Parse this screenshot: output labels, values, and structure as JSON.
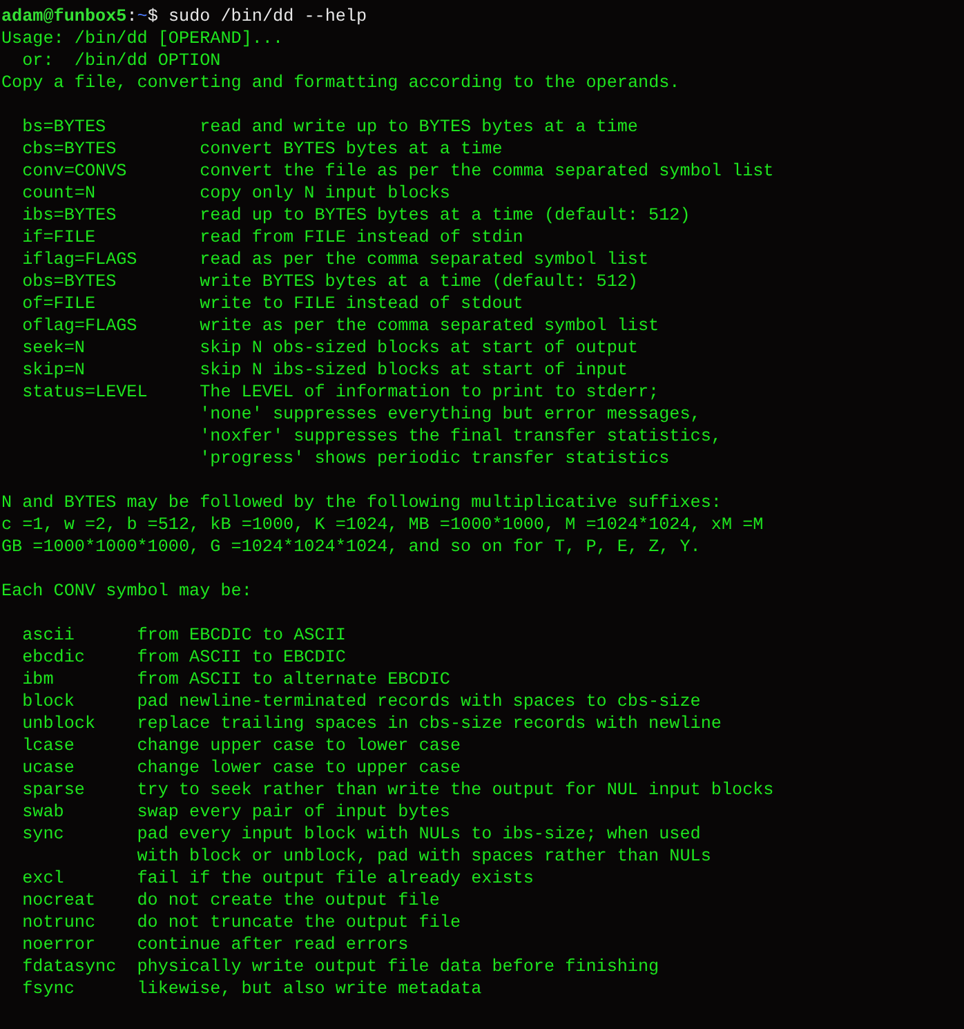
{
  "prompt": {
    "user_host": "adam@funbox5",
    "separator": ":",
    "path": "~",
    "symbol": "$",
    "command": "sudo /bin/dd --help"
  },
  "usage": [
    "Usage: /bin/dd [OPERAND]...",
    "  or:  /bin/dd OPTION",
    "Copy a file, converting and formatting according to the operands."
  ],
  "operands": [
    {
      "name": "bs=BYTES",
      "description": "read and write up to BYTES bytes at a time"
    },
    {
      "name": "cbs=BYTES",
      "description": "convert BYTES bytes at a time"
    },
    {
      "name": "conv=CONVS",
      "description": "convert the file as per the comma separated symbol list"
    },
    {
      "name": "count=N",
      "description": "copy only N input blocks"
    },
    {
      "name": "ibs=BYTES",
      "description": "read up to BYTES bytes at a time (default: 512)"
    },
    {
      "name": "if=FILE",
      "description": "read from FILE instead of stdin"
    },
    {
      "name": "iflag=FLAGS",
      "description": "read as per the comma separated symbol list"
    },
    {
      "name": "obs=BYTES",
      "description": "write BYTES bytes at a time (default: 512)"
    },
    {
      "name": "of=FILE",
      "description": "write to FILE instead of stdout"
    },
    {
      "name": "oflag=FLAGS",
      "description": "write as per the comma separated symbol list"
    },
    {
      "name": "seek=N",
      "description": "skip N obs-sized blocks at start of output"
    },
    {
      "name": "skip=N",
      "description": "skip N ibs-sized blocks at start of input"
    },
    {
      "name": "status=LEVEL",
      "description": "The LEVEL of information to print to stderr;",
      "continuation": [
        "'none' suppresses everything but error messages,",
        "'noxfer' suppresses the final transfer statistics,",
        "'progress' shows periodic transfer statistics"
      ]
    }
  ],
  "suffixes": [
    "N and BYTES may be followed by the following multiplicative suffixes:",
    "c =1, w =2, b =512, kB =1000, K =1024, MB =1000*1000, M =1024*1024, xM =M",
    "GB =1000*1000*1000, G =1024*1024*1024, and so on for T, P, E, Z, Y."
  ],
  "conv_heading": "Each CONV symbol may be:",
  "conv_symbols": [
    {
      "name": "ascii",
      "description": "from EBCDIC to ASCII"
    },
    {
      "name": "ebcdic",
      "description": "from ASCII to EBCDIC"
    },
    {
      "name": "ibm",
      "description": "from ASCII to alternate EBCDIC"
    },
    {
      "name": "block",
      "description": "pad newline-terminated records with spaces to cbs-size"
    },
    {
      "name": "unblock",
      "description": "replace trailing spaces in cbs-size records with newline"
    },
    {
      "name": "lcase",
      "description": "change upper case to lower case"
    },
    {
      "name": "ucase",
      "description": "change lower case to upper case"
    },
    {
      "name": "sparse",
      "description": "try to seek rather than write the output for NUL input blocks"
    },
    {
      "name": "swab",
      "description": "swap every pair of input bytes"
    },
    {
      "name": "sync",
      "description": "pad every input block with NULs to ibs-size; when used",
      "continuation": [
        "with block or unblock, pad with spaces rather than NULs"
      ]
    },
    {
      "name": "excl",
      "description": "fail if the output file already exists"
    },
    {
      "name": "nocreat",
      "description": "do not create the output file"
    },
    {
      "name": "notrunc",
      "description": "do not truncate the output file"
    },
    {
      "name": "noerror",
      "description": "continue after read errors"
    },
    {
      "name": "fdatasync",
      "description": "physically write output file data before finishing"
    },
    {
      "name": "fsync",
      "description": "likewise, but also write metadata"
    }
  ]
}
